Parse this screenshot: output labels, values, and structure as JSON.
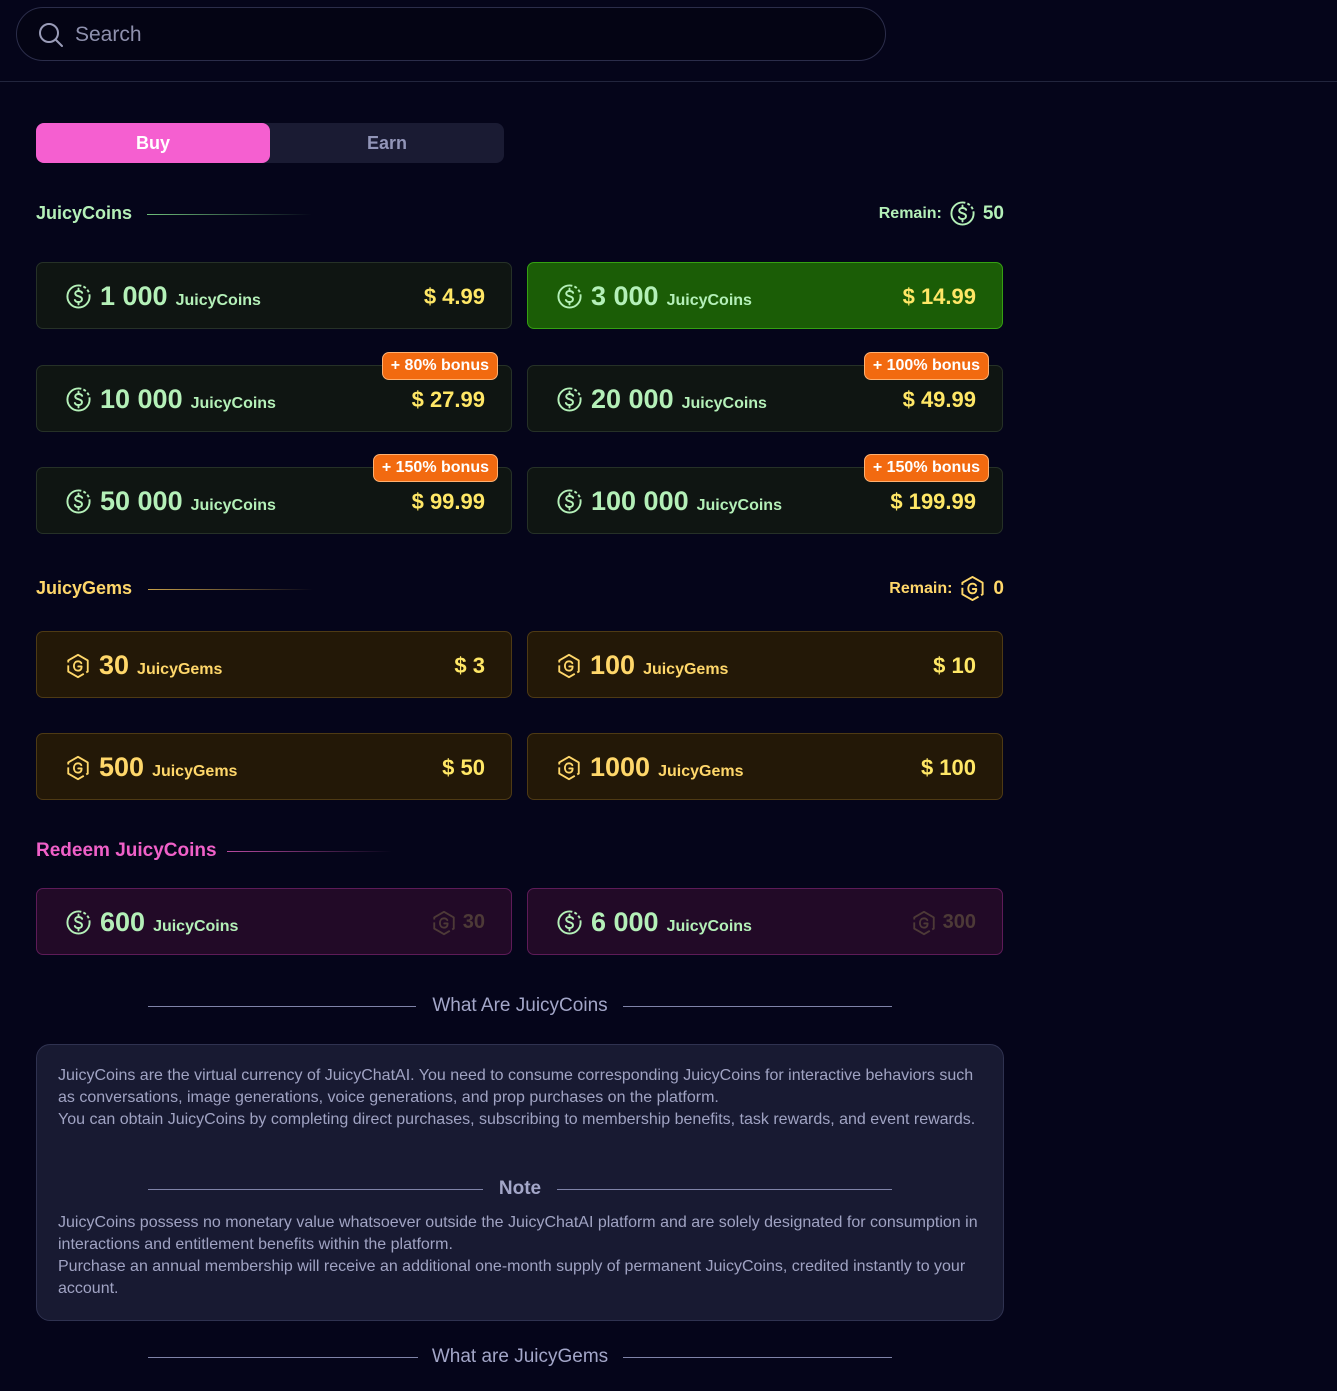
{
  "search": {
    "placeholder": "Search"
  },
  "tabs": [
    {
      "label": "Buy",
      "active": true
    },
    {
      "label": "Earn",
      "active": false
    }
  ],
  "colors": {
    "accent_pink": "#f55fd0",
    "coin_green": "#b4f0b8",
    "gem_gold": "#ffd76a",
    "price_yellow": "#ffe766",
    "bonus_orange": "#f26a10",
    "selected_green": "#1b5d06"
  },
  "juicycoins": {
    "title": "JuicyCoins",
    "remain_label": "Remain:",
    "remain_value": "50",
    "icon": "dollar-circle-icon",
    "packages": [
      {
        "amount": "1 000",
        "unit": "JuicyCoins",
        "price": "$ 4.99",
        "bonus": "",
        "selected": false
      },
      {
        "amount": "3 000",
        "unit": "JuicyCoins",
        "price": "$ 14.99",
        "bonus": "",
        "selected": true
      },
      {
        "amount": "10 000",
        "unit": "JuicyCoins",
        "price": "$ 27.99",
        "bonus": "+ 80% bonus",
        "selected": false
      },
      {
        "amount": "20 000",
        "unit": "JuicyCoins",
        "price": "$ 49.99",
        "bonus": "+ 100% bonus",
        "selected": false
      },
      {
        "amount": "50 000",
        "unit": "JuicyCoins",
        "price": "$ 99.99",
        "bonus": "+ 150% bonus",
        "selected": false
      },
      {
        "amount": "100 000",
        "unit": "JuicyCoins",
        "price": "$ 199.99",
        "bonus": "+ 150% bonus",
        "selected": false
      }
    ]
  },
  "juicygems": {
    "title": "JuicyGems",
    "remain_label": "Remain:",
    "remain_value": "0",
    "icon": "gem-g-icon",
    "packages": [
      {
        "amount": "30",
        "unit": "JuicyGems",
        "price": "$ 3"
      },
      {
        "amount": "100",
        "unit": "JuicyGems",
        "price": "$ 10"
      },
      {
        "amount": "500",
        "unit": "JuicyGems",
        "price": "$ 50"
      },
      {
        "amount": "1000",
        "unit": "JuicyGems",
        "price": "$ 100"
      }
    ]
  },
  "redeem": {
    "title": "Redeem JuicyCoins",
    "items": [
      {
        "amount": "600",
        "unit": "JuicyCoins",
        "cost": "30"
      },
      {
        "amount": "6 000",
        "unit": "JuicyCoins",
        "cost": "300"
      }
    ]
  },
  "info": {
    "heading": "What Are JuicyCoins",
    "para1": "JuicyCoins are the virtual currency of JuicyChatAI. You need to consume corresponding JuicyCoins for interactive behaviors such as conversations, image generations, voice generations, and prop purchases on the platform.",
    "para2": "You can obtain JuicyCoins by completing direct purchases, subscribing to membership benefits, task rewards, and event rewards.",
    "note_heading": "Note",
    "note1": "JuicyCoins possess no monetary value whatsoever outside the JuicyChatAI platform and are solely designated for consumption in interactions and entitlement benefits within the platform.",
    "note2": "Purchase an annual membership will receive an additional one-month supply of permanent JuicyCoins, credited instantly to your account.",
    "gems_heading": "What are JuicyGems"
  }
}
